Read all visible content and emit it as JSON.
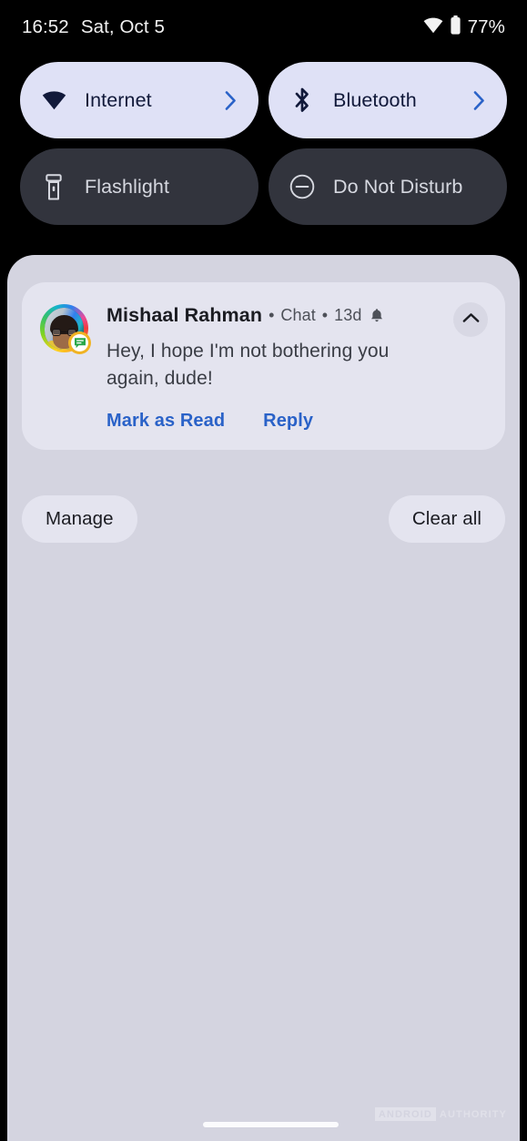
{
  "status_bar": {
    "clock": "16:52",
    "date": "Sat, Oct 5",
    "battery_percent": "77%",
    "wifi_icon": "wifi-icon",
    "battery_icon": "battery-icon"
  },
  "quick_settings": {
    "tiles": [
      {
        "label": "Internet",
        "icon": "wifi-icon",
        "state": "on",
        "has_chevron": true,
        "name": "qs-tile-internet"
      },
      {
        "label": "Bluetooth",
        "icon": "bluetooth-icon",
        "state": "on",
        "has_chevron": true,
        "name": "qs-tile-bluetooth"
      },
      {
        "label": "Flashlight",
        "icon": "flashlight-icon",
        "state": "off",
        "has_chevron": false,
        "name": "qs-tile-flashlight"
      },
      {
        "label": "Do Not Disturb",
        "icon": "do-not-disturb-icon",
        "state": "off",
        "has_chevron": false,
        "name": "qs-tile-do-not-disturb"
      }
    ]
  },
  "notification": {
    "sender": "Mishaal Rahman",
    "separator_1": "•",
    "channel": "Chat",
    "separator_2": "•",
    "time": "13d",
    "alert_icon": "bell-icon",
    "message": "Hey, I hope I'm not bothering you again, dude!",
    "actions": [
      {
        "label": "Mark as Read",
        "name": "notification-action-mark-as-read"
      },
      {
        "label": "Reply",
        "name": "notification-action-reply"
      }
    ],
    "collapse_icon": "chevron-up-icon",
    "avatar": "avatar",
    "app_badge_icon": "chat-bubble-icon"
  },
  "shade_footer": {
    "manage_label": "Manage",
    "clear_all_label": "Clear all"
  },
  "watermark": {
    "box_text": "ANDROID",
    "text": "AUTHORITY"
  },
  "colors": {
    "tile_on_bg": "#dfe1f6",
    "tile_on_fg": "#11193a",
    "tile_off_bg": "#32343d",
    "tile_off_fg": "#d6d8e0",
    "shade_bg": "#d4d4e0",
    "card_bg": "#e4e4ef",
    "action_blue": "#2a62c8",
    "status_bg": "#000000"
  }
}
